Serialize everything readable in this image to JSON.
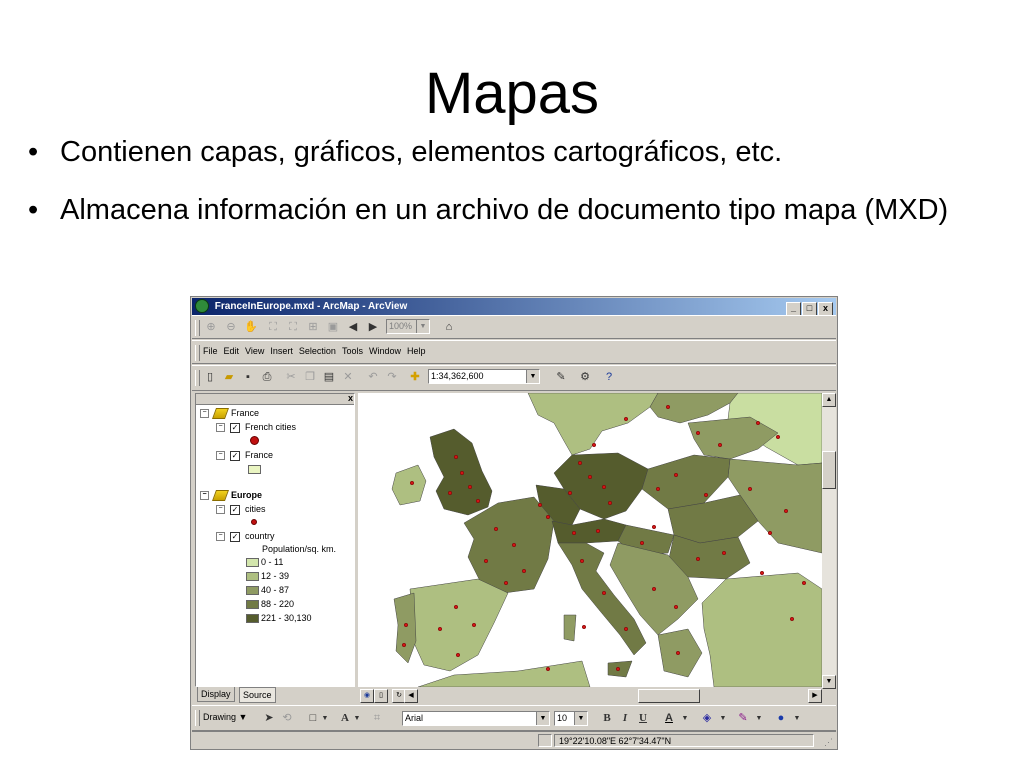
{
  "slide": {
    "title": "Mapas",
    "bullets": [
      "Contienen capas, gráficos, elementos cartográficos, etc.",
      "Almacena información en un archivo de documento tipo mapa (MXD)"
    ]
  },
  "window": {
    "title": "FranceInEurope.mxd - ArcMap - ArcView",
    "controls": {
      "minimize": "_",
      "maximize": "□",
      "close": "x"
    }
  },
  "tools_toolbar": {
    "zoom_value": "100%"
  },
  "menubar": {
    "items": [
      "File",
      "Edit",
      "View",
      "Insert",
      "Selection",
      "Tools",
      "Window",
      "Help"
    ]
  },
  "standard_toolbar": {
    "scale_value": "1:34,362,600"
  },
  "toc": {
    "close_label": "x",
    "france_group": {
      "label": "France"
    },
    "french_cities": {
      "label": "French cities"
    },
    "france_layer": {
      "label": "France"
    },
    "europe_group": {
      "label": "Europe"
    },
    "cities": {
      "label": "cities"
    },
    "country": {
      "label": "country"
    },
    "legend_heading": "Population/sq. km.",
    "legend": [
      {
        "label": "0 - 11",
        "color": "#d3e6ad"
      },
      {
        "label": "12 - 39",
        "color": "#aebf81"
      },
      {
        "label": "40 - 87",
        "color": "#8f9b63"
      },
      {
        "label": "88 - 220",
        "color": "#717a45"
      },
      {
        "label": "221 - 30,130",
        "color": "#555c2d"
      }
    ],
    "tabs": {
      "display": "Display",
      "source": "Source"
    }
  },
  "drawing_toolbar": {
    "drawing_label": "Drawing",
    "font_name": "Arial",
    "font_size": "10",
    "bold": "B",
    "italic": "I",
    "underline": "U",
    "font_color_letter": "A"
  },
  "statusbar": {
    "coordinates": "19°22'10.08\"E  62°7'34.47\"N"
  }
}
